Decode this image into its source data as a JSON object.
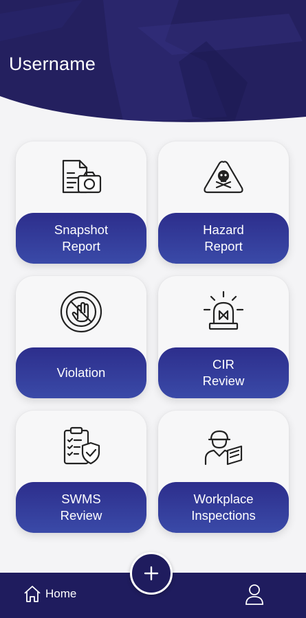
{
  "header": {
    "username": "Username"
  },
  "cards": [
    {
      "label": "Snapshot\nReport",
      "icon": "snapshot-report-icon"
    },
    {
      "label": "Hazard\nReport",
      "icon": "hazard-icon"
    },
    {
      "label": "Violation",
      "icon": "stop-hand-icon"
    },
    {
      "label": "CIR\nReview",
      "icon": "alarm-light-icon"
    },
    {
      "label": "SWMS\nReview",
      "icon": "checklist-shield-icon"
    },
    {
      "label": "Workplace\nInspections",
      "icon": "inspector-icon"
    }
  ],
  "bottom_nav": {
    "home_label": "Home",
    "home_icon": "home-icon",
    "fab_icon": "plus-icon",
    "profile_icon": "user-icon"
  },
  "colors": {
    "primary": "#1f1c5e",
    "band_top": "#2d2e8c",
    "band_bottom": "#3a4aa8",
    "background": "#f4f4f6"
  }
}
